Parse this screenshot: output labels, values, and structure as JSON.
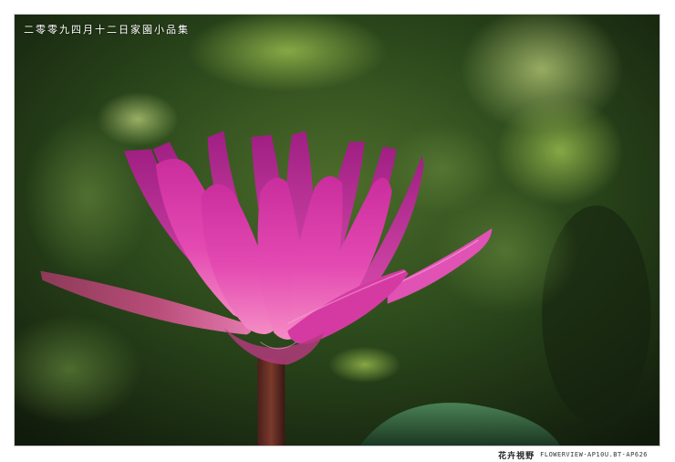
{
  "caption": {
    "text": "二零零九四月十二日家園小品集"
  },
  "footer": {
    "brand": "花卉視野",
    "credit": "FLOWERVIEW·AP10U.BT·AP626"
  },
  "colors": {
    "background_green": "#2d4a1f",
    "petal_pink": "#e24bb5",
    "petal_light": "#f4a7dc",
    "frame_border": "#cfcfcf"
  }
}
